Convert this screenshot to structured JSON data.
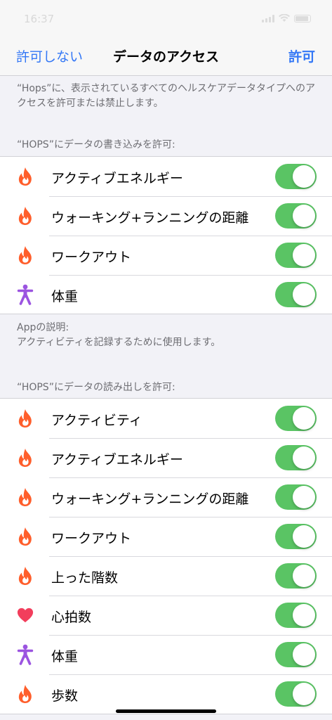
{
  "status_bar": {
    "time": "16:37"
  },
  "nav": {
    "left_button": "許可しない",
    "title": "データのアクセス",
    "right_button": "許可"
  },
  "description": "“Hops”に、表示されているすべてのヘルスケアデータタイプへのアクセスを許可または禁止します。",
  "write_section": {
    "header": "“HOPS”にデータの書き込みを許可:",
    "items": [
      {
        "label": "アクティブエネルギー",
        "icon": "flame-icon",
        "on": true
      },
      {
        "label": "ウォーキング+ランニングの距離",
        "icon": "flame-icon",
        "on": true
      },
      {
        "label": "ワークアウト",
        "icon": "flame-icon",
        "on": true
      },
      {
        "label": "体重",
        "icon": "person-icon",
        "on": true
      }
    ]
  },
  "app_description": {
    "title": "Appの説明:",
    "text": "アクティビティを記録するために使用します。"
  },
  "read_section": {
    "header": "“HOPS”にデータの読み出しを許可:",
    "items": [
      {
        "label": "アクティビティ",
        "icon": "flame-icon",
        "on": true
      },
      {
        "label": "アクティブエネルギー",
        "icon": "flame-icon",
        "on": true
      },
      {
        "label": "ウォーキング+ランニングの距離",
        "icon": "flame-icon",
        "on": true
      },
      {
        "label": "ワークアウト",
        "icon": "flame-icon",
        "on": true
      },
      {
        "label": "上った階数",
        "icon": "flame-icon",
        "on": true
      },
      {
        "label": "心拍数",
        "icon": "heart-icon",
        "on": true
      },
      {
        "label": "体重",
        "icon": "person-icon",
        "on": true
      },
      {
        "label": "歩数",
        "icon": "flame-icon",
        "on": true
      }
    ]
  },
  "colors": {
    "accent": "#3478f6",
    "toggle_on": "#5ac464",
    "flame": "#ff5e2b",
    "heart": "#f23e5c",
    "person": "#9b54e0"
  }
}
